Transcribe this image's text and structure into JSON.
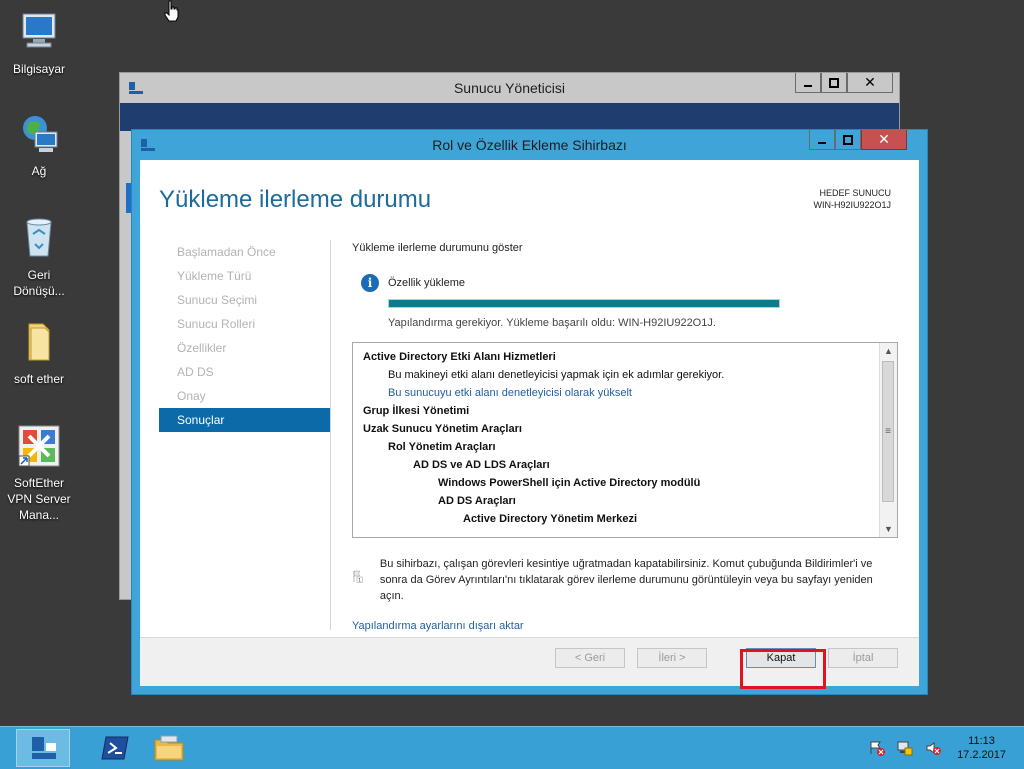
{
  "desktop": {
    "icons": [
      {
        "label": "Bilgisayar",
        "icon": "computer-icon"
      },
      {
        "label": "Ağ",
        "icon": "network-icon"
      },
      {
        "label": "Geri Dönüşü...",
        "icon": "recycle-bin-icon"
      },
      {
        "label": "soft ether",
        "icon": "folder-icon"
      },
      {
        "label": "SoftEther VPN Server Mana...",
        "icon": "softether-icon"
      }
    ]
  },
  "back_window": {
    "title": "Sunucu Yöneticisi"
  },
  "wizard": {
    "title": "Rol ve Özellik Ekleme Sihirbazı",
    "heading": "Yükleme ilerleme durumu",
    "target_label": "HEDEF SUNUCU",
    "target_server": "WIN-H92IU922O1J",
    "nav": [
      {
        "label": "Başlamadan Önce",
        "active": false
      },
      {
        "label": "Yükleme Türü",
        "active": false
      },
      {
        "label": "Sunucu Seçimi",
        "active": false
      },
      {
        "label": "Sunucu Rolleri",
        "active": false
      },
      {
        "label": "Özellikler",
        "active": false
      },
      {
        "label": "AD DS",
        "active": false
      },
      {
        "label": "Onay",
        "active": false
      },
      {
        "label": "Sonuçlar",
        "active": true
      }
    ],
    "section_title": "Yükleme ilerleme durumunu göster",
    "feature_label": "Özellik yükleme",
    "progress": 1.0,
    "result_text": "Yapılandırma gerekiyor. Yükleme başarılı oldu: WIN-H92IU922O1J.",
    "results": [
      {
        "text": "Active Directory Etki Alanı Hizmetleri",
        "bold": true,
        "indent": 0,
        "link": false
      },
      {
        "text": "Bu makineyi etki alanı denetleyicisi yapmak için ek adımlar gerekiyor.",
        "bold": false,
        "indent": 1,
        "link": false
      },
      {
        "text": "Bu sunucuyu etki alanı denetleyicisi olarak yükselt",
        "bold": false,
        "indent": 1,
        "link": true
      },
      {
        "text": "Grup İlkesi Yönetimi",
        "bold": true,
        "indent": 0,
        "link": false
      },
      {
        "text": "Uzak Sunucu Yönetim Araçları",
        "bold": true,
        "indent": 0,
        "link": false
      },
      {
        "text": "Rol Yönetim Araçları",
        "bold": true,
        "indent": 1,
        "link": false
      },
      {
        "text": "AD DS ve AD LDS Araçları",
        "bold": true,
        "indent": 2,
        "link": false
      },
      {
        "text": "Windows PowerShell için Active Directory modülü",
        "bold": true,
        "indent": 3,
        "link": false
      },
      {
        "text": "AD DS Araçları",
        "bold": true,
        "indent": 3,
        "link": false
      },
      {
        "text": "Active Directory Yönetim Merkezi",
        "bold": true,
        "indent": 4,
        "link": false
      }
    ],
    "note": "Bu sihirbazı, çalışan görevleri kesintiye uğratmadan kapatabilirsiniz. Komut çubuğunda Bildirimler'i ve sonra da Görev Ayrıntıları'nı tıklatarak görev ilerleme durumunu görüntüleyin veya bu sayfayı yeniden açın.",
    "note_badge": "1",
    "export_link": "Yapılandırma ayarlarını dışarı aktar",
    "buttons": {
      "prev": "< Geri",
      "next": "İleri >",
      "close": "Kapat",
      "cancel": "İptal"
    }
  },
  "taskbar": {
    "time": "11:13",
    "date": "17.2.2017"
  },
  "colors": {
    "accent": "#0c6aa8",
    "progress": "#0f7a8f",
    "highlight": "#e0141e",
    "taskbar": "#38a0d4"
  }
}
